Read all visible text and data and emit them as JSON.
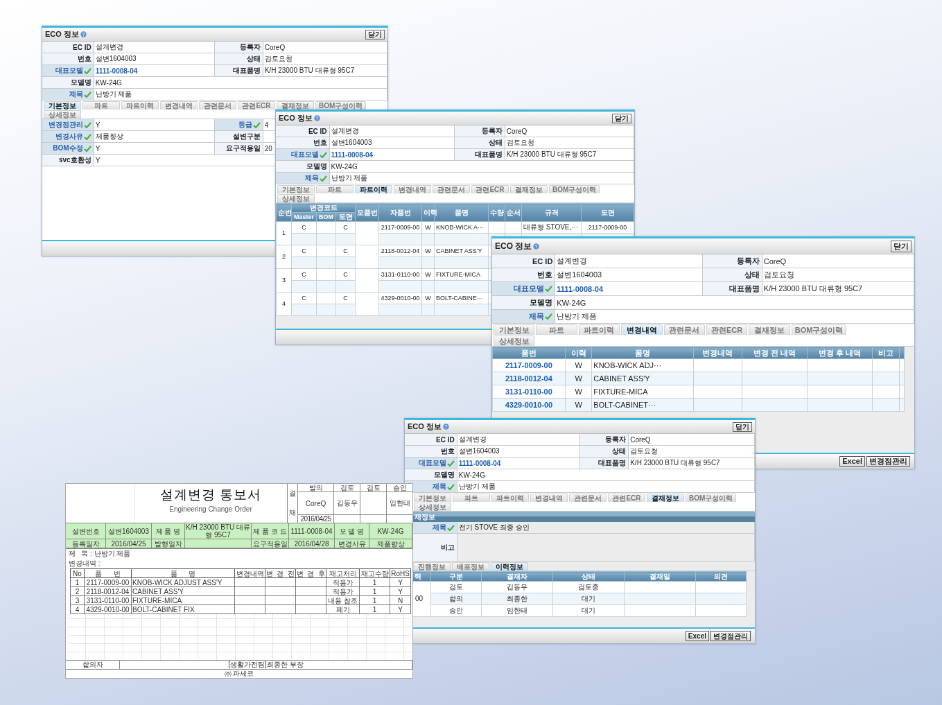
{
  "windows": [
    {
      "title": "ECO 정보",
      "close": "닫기",
      "fields": [
        [
          {
            "label": "EC ID",
            "value": "설계변경",
            "checked": false,
            "link": false
          },
          {
            "label": "등록자",
            "value": "CoreQ",
            "checked": false,
            "link": false
          }
        ],
        [
          {
            "label": "번호",
            "value": "설변1604003",
            "checked": false,
            "link": false
          },
          {
            "label": "상태",
            "value": "검토요청",
            "checked": false,
            "link": false
          }
        ],
        [
          {
            "label": "대표모델",
            "value": "1111-0008-04",
            "checked": true,
            "link": true
          },
          {
            "label": "대표품명",
            "value": "K/H 23000 BTU 대류형 95C7",
            "checked": false,
            "link": false
          }
        ],
        [
          {
            "label": "모델명",
            "value": "KW-24G",
            "checked": false,
            "link": false
          }
        ],
        [
          {
            "label": "제목",
            "value": "난방기 제품",
            "checked": true,
            "link": false
          }
        ]
      ],
      "tabs": [
        {
          "label": "기본정보",
          "selected": true
        },
        {
          "label": "파트",
          "selected": false
        },
        {
          "label": "파트이력",
          "selected": false
        },
        {
          "label": "변경내역",
          "selected": false
        },
        {
          "label": "관련문서",
          "selected": false
        },
        {
          "label": "관련ECR",
          "selected": false
        },
        {
          "label": "결재정보",
          "selected": false
        },
        {
          "label": "BOM구성이력",
          "selected": false
        },
        {
          "label": "상세정보",
          "selected": false
        }
      ],
      "body": {
        "kind": "detail",
        "fields": [
          [
            {
              "label": "변경점관리",
              "value": "Y",
              "checked": true
            },
            {
              "label": "등급",
              "value": "4",
              "checked": true
            }
          ],
          [
            {
              "label": "변경사유",
              "value": "제품향상",
              "checked": true
            },
            {
              "label": "설변구분",
              "checked": false
            }
          ],
          [
            {
              "label": "BOM수정",
              "value": "Y",
              "checked": true
            },
            {
              "label": "요구적용일",
              "value": "20",
              "checked": false
            }
          ],
          [
            {
              "label": "svc호환성",
              "value": "Y",
              "checked": false
            }
          ]
        ]
      }
    },
    {
      "title": "ECO 정보",
      "close": "닫기",
      "fields": [
        [
          {
            "label": "EC ID",
            "value": "설계변경",
            "checked": false,
            "link": false
          },
          {
            "label": "등록자",
            "value": "CoreQ",
            "checked": false,
            "link": false
          }
        ],
        [
          {
            "label": "번호",
            "value": "설변1604003",
            "checked": false,
            "link": false
          },
          {
            "label": "상태",
            "value": "검토요청",
            "checked": false,
            "link": false
          }
        ],
        [
          {
            "label": "대표모델",
            "value": "1111-0008-04",
            "checked": true,
            "link": true
          },
          {
            "label": "대표품명",
            "value": "K/H 23000 BTU 대류형 95C7",
            "checked": false,
            "link": false
          }
        ],
        [
          {
            "label": "모델명",
            "value": "KW-24G",
            "checked": false,
            "link": false
          }
        ],
        [
          {
            "label": "제목",
            "value": "난방기 제품",
            "checked": true,
            "link": false
          }
        ]
      ],
      "tabs": [
        {
          "label": "기본정보",
          "selected": false
        },
        {
          "label": "파트",
          "selected": false
        },
        {
          "label": "파트이력",
          "selected": true
        },
        {
          "label": "변경내역",
          "selected": false
        },
        {
          "label": "관련문서",
          "selected": false
        },
        {
          "label": "관련ECR",
          "selected": false
        },
        {
          "label": "결재정보",
          "selected": false
        },
        {
          "label": "BOM구성이력",
          "selected": false
        },
        {
          "label": "상세정보",
          "selected": false
        }
      ],
      "body": {
        "kind": "part_history",
        "lead_column": "순번",
        "group": {
          "label": "변경코드",
          "columns": [
            "Master",
            "BOM",
            "도면"
          ]
        },
        "columns": [
          "모품번",
          "자품번",
          "이력",
          "품명",
          "수량",
          "순서",
          "규격",
          "도면"
        ],
        "rows": [
          {
            "no": "1",
            "master": "C",
            "drawing": "C",
            "child": "2117-0009-00",
            "rev": "W",
            "name": "KNOB-WICK A···",
            "spec": "대류형 STOVE,···",
            "drawing_no": "2117-0009-00"
          },
          {
            "no": "2",
            "master": "C",
            "drawing": "C",
            "child": "2118-0012-04",
            "rev": "W",
            "name": "CABINET ASS'Y"
          },
          {
            "no": "3",
            "master": "C",
            "drawing": "C",
            "child": "3131-0110-00",
            "rev": "W",
            "name": "FIXTURE-MICA"
          },
          {
            "no": "4",
            "master": "C",
            "drawing": "C",
            "child": "4329-0010-00",
            "rev": "W",
            "name": "BOLT-CABINE···"
          }
        ]
      }
    },
    {
      "title": "ECO 정보",
      "close": "닫기",
      "fields": [
        [
          {
            "label": "EC ID",
            "value": "설계변경",
            "checked": false,
            "link": false
          },
          {
            "label": "등록자",
            "value": "CoreQ",
            "checked": false,
            "link": false
          }
        ],
        [
          {
            "label": "번호",
            "value": "설변1604003",
            "checked": false,
            "link": false
          },
          {
            "label": "상태",
            "value": "검토요청",
            "checked": false,
            "link": false
          }
        ],
        [
          {
            "label": "대표모델",
            "value": "1111-0008-04",
            "checked": true,
            "link": true
          },
          {
            "label": "대표품명",
            "value": "K/H 23000 BTU 대류형 95C7",
            "checked": false,
            "link": false
          }
        ],
        [
          {
            "label": "모델명",
            "value": "KW-24G",
            "checked": false,
            "link": false
          }
        ],
        [
          {
            "label": "제목",
            "value": "난방기 제품",
            "checked": true,
            "link": false
          }
        ]
      ],
      "tabs": [
        {
          "label": "기본정보",
          "selected": false
        },
        {
          "label": "파트",
          "selected": false
        },
        {
          "label": "파트이력",
          "selected": false
        },
        {
          "label": "변경내역",
          "selected": true
        },
        {
          "label": "관련문서",
          "selected": false
        },
        {
          "label": "관련ECR",
          "selected": false
        },
        {
          "label": "결재정보",
          "selected": false
        },
        {
          "label": "BOM구성이력",
          "selected": false
        },
        {
          "label": "상세정보",
          "selected": false
        }
      ],
      "body": {
        "kind": "change_list",
        "columns": [
          "품번",
          "이력",
          "품명",
          "변경내역",
          "변경 전 내역",
          "변경 후 내역",
          "비고"
        ],
        "rows": [
          {
            "part_no": "2117-0009-00",
            "rev": "W",
            "name": "KNOB-WICK ADJ···"
          },
          {
            "part_no": "2118-0012-04",
            "rev": "W",
            "name": "CABINET ASS'Y"
          },
          {
            "part_no": "3131-0110-00",
            "rev": "W",
            "name": "FIXTURE-MICA"
          },
          {
            "part_no": "4329-0010-00",
            "rev": "W",
            "name": "BOLT-CABINET···"
          }
        ]
      },
      "buttons": [
        "Excel",
        "변경점관리"
      ]
    },
    {
      "title": "ECO 정보",
      "close": "닫기",
      "fields": [
        [
          {
            "label": "EC ID",
            "value": "설계변경",
            "checked": false,
            "link": false
          },
          {
            "label": "등록자",
            "value": "CoreQ",
            "checked": false,
            "link": false
          }
        ],
        [
          {
            "label": "번호",
            "value": "설변1604003",
            "checked": false,
            "link": false
          },
          {
            "label": "상태",
            "value": "검토요청",
            "checked": false,
            "link": false
          }
        ],
        [
          {
            "label": "대표모델",
            "value": "1111-0008-04",
            "checked": true,
            "link": true
          },
          {
            "label": "대표품명",
            "value": "K/H 23000 BTU 대류형 95C7",
            "checked": false,
            "link": false
          }
        ],
        [
          {
            "label": "모델명",
            "value": "KW-24G",
            "checked": false,
            "link": false
          }
        ],
        [
          {
            "label": "제목",
            "value": "난방기 제품",
            "checked": true,
            "link": false
          }
        ]
      ],
      "tabs": [
        {
          "label": "기본정보",
          "selected": false
        },
        {
          "label": "파트",
          "selected": false
        },
        {
          "label": "파트이력",
          "selected": false
        },
        {
          "label": "변경내역",
          "selected": false
        },
        {
          "label": "관련문서",
          "selected": false
        },
        {
          "label": "관련ECR",
          "selected": false
        },
        {
          "label": "결재정보",
          "selected": true
        },
        {
          "label": "BOM구성이력",
          "selected": false
        },
        {
          "label": "상세정보",
          "selected": false
        }
      ],
      "body": {
        "kind": "approval",
        "section": "재정보",
        "subject": {
          "label": "제목",
          "value": "전기 STOVE 최종 승인",
          "checked": true
        },
        "memo": {
          "label": "비고"
        },
        "tabs": [
          {
            "label": "진행정보",
            "selected": false
          },
          {
            "label": "배포정보",
            "selected": false
          },
          {
            "label": "이력정보",
            "selected": true
          }
        ],
        "columns": [
          "력",
          "구분",
          "결재자",
          "상태",
          "결재일",
          "의견"
        ],
        "revision": "00",
        "rows": [
          {
            "type": "검토",
            "approver": "김동우",
            "status": "검토중"
          },
          {
            "type": "합의",
            "approver": "최종한",
            "status": "대기"
          },
          {
            "type": "승인",
            "approver": "임한태",
            "status": "대기"
          }
        ]
      },
      "buttons": [
        "Excel",
        "변경점관리"
      ]
    }
  ],
  "document": {
    "title": "설계변경 통보서",
    "subtitle": "Engineering Change Order",
    "approval_label": [
      "결",
      "재"
    ],
    "approvals": [
      {
        "role": "발의",
        "name": "CoreQ",
        "date": "2016/04/25"
      },
      {
        "role": "검토",
        "name": "김동우"
      },
      {
        "role": "검토"
      },
      {
        "role": "승인",
        "name": "임한태"
      }
    ],
    "info": [
      [
        {
          "label": "설변번호",
          "value": "설변1604003"
        },
        {
          "label": "제 품 명",
          "value": "K/H 23000 BTU 대류형 95C7"
        },
        {
          "label": "제 품 코 드",
          "value": "1111-0008-04"
        },
        {
          "label": "모 델 명",
          "value": "KW-24G"
        }
      ],
      [
        {
          "label": "등록일자",
          "value": "2016/04/25"
        },
        {
          "label": "발행일자"
        },
        {
          "label": "요구적용일",
          "value": "2016/04/28"
        },
        {
          "label": "변경사유",
          "value": "제품향상"
        }
      ]
    ],
    "subject": "제   목 : 난방기 제품",
    "changes_label": "변경내역 :",
    "columns": [
      "No",
      "품      번",
      "품      명",
      "변경내역",
      "변  경  전",
      "변  경  후",
      "재고처리",
      "재고수량",
      "RoHS"
    ],
    "rows": [
      {
        "no": "1",
        "part_no": "2117-0009-00",
        "name": "KNOB-WICK ADJUST ASS'Y",
        "stock": "적용가",
        "qty": "1",
        "rohs": "Y"
      },
      {
        "no": "2",
        "part_no": "2118-0012-04",
        "name": "CABINET ASS'Y",
        "stock": "적용가",
        "qty": "1",
        "rohs": "Y"
      },
      {
        "no": "3",
        "part_no": "3131-0110-00",
        "name": "FIXTURE-MICA",
        "stock": "내용 참조",
        "qty": "1",
        "rohs": "N"
      },
      {
        "no": "4",
        "part_no": "4329-0010-00",
        "name": "BOLT-CABINET FIX",
        "stock": "폐기",
        "qty": "1",
        "rohs": "Y"
      }
    ],
    "footer": {
      "label": "합의자",
      "value": "[생활가전팀]최종한 부장"
    },
    "company": "㈜ 파세코"
  }
}
